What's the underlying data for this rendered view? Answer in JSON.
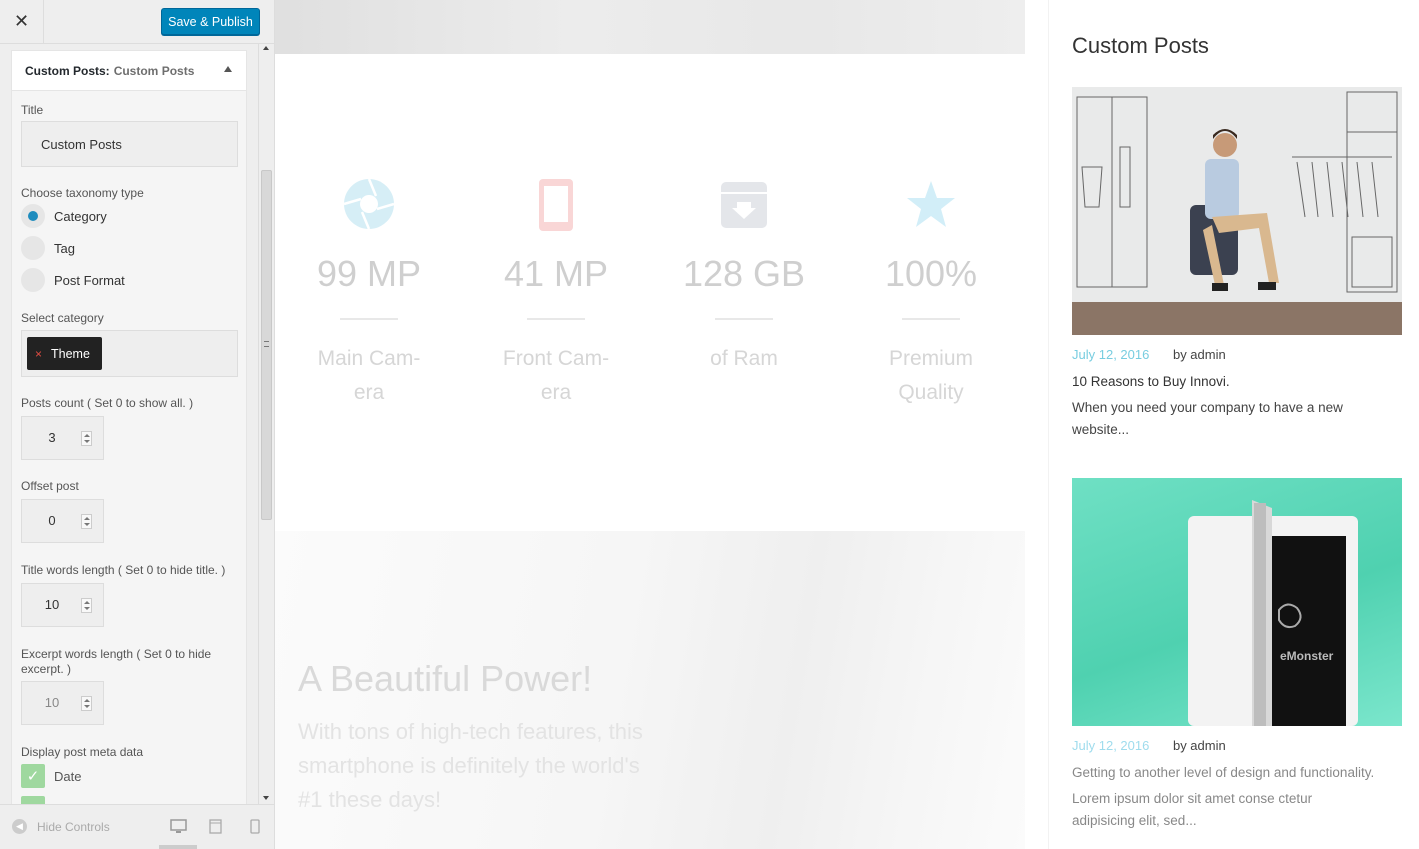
{
  "topbar": {
    "close_glyph": "✕",
    "publish_label": "Save & Publish"
  },
  "widget": {
    "header_bold": "Custom Posts:",
    "header_sub": "Custom Posts",
    "title_label": "Title",
    "title_value": "Custom Posts",
    "taxonomy_label": "Choose taxonomy type",
    "taxonomy_options": [
      "Category",
      "Tag",
      "Post Format"
    ],
    "taxonomy_selected": "Category",
    "category_label": "Select category",
    "category_tags": [
      {
        "remove": "×",
        "label": "Theme"
      }
    ],
    "posts_count_label": "Posts count ( Set 0 to show all. )",
    "posts_count": "3",
    "offset_label": "Offset post",
    "offset": "0",
    "title_words_label": "Title words length ( Set 0 to hide title. )",
    "title_words": "10",
    "excerpt_words_label": "Excerpt words length ( Set 0 to hide excerpt. )",
    "excerpt_words": "10",
    "meta_label": "Display post meta data",
    "meta_options": [
      {
        "label": "Date",
        "checked": true
      }
    ]
  },
  "footer": {
    "hide_controls": "Hide Controls",
    "icons": [
      "desktop-icon",
      "tablet-icon",
      "mobile-icon"
    ]
  },
  "preview": {
    "stats": [
      {
        "icon": "aperture-icon",
        "value": "99 MP",
        "caption_line1": "Main Cam-",
        "caption_line2": "era",
        "color": "#d6eef6"
      },
      {
        "icon": "phone-icon",
        "value": "41 MP",
        "caption_line1": "Front Cam-",
        "caption_line2": "era",
        "color": "#f9d6d6"
      },
      {
        "icon": "archive-icon",
        "value": "128 GB",
        "caption_line1": "of Ram",
        "caption_line2": "",
        "color": "#e4e6ea"
      },
      {
        "icon": "star-icon",
        "value": "100%",
        "caption_line1": "Premium",
        "caption_line2": "Quality",
        "color": "#d2eef8"
      }
    ],
    "power_title": "A Beautiful Power!",
    "power_text": "With tons of high-tech features, this smartphone is definitely the world's #1 these days!"
  },
  "custom_posts": {
    "heading": "Custom Posts",
    "posts": [
      {
        "date": "July 12, 2016",
        "author": "by admin",
        "title": "10 Reasons to Buy Innovi.",
        "excerpt": "When you need your company to have a new website..."
      },
      {
        "date": "July 12, 2016",
        "author": "by admin",
        "title": "Getting to another level of design and functionality.",
        "excerpt": "Lorem ipsum dolor sit amet conse ctetur adipisicing elit, sed..."
      }
    ],
    "tablet_brand": "eMonster"
  },
  "colors": {
    "accent": "#0085ba",
    "date": "#78cde0"
  }
}
